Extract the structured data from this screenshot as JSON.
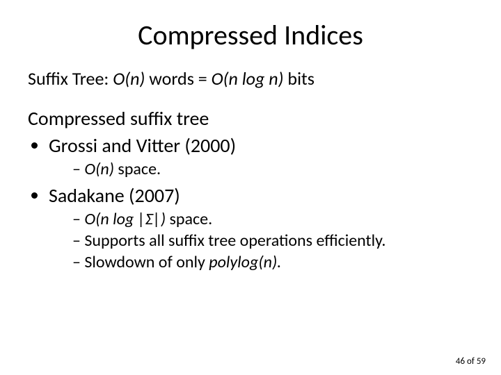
{
  "title": "Compressed Indices",
  "line1": {
    "prefix": "Suffix Tree: ",
    "o_n": "O(n)",
    "words_eq": " words = ",
    "o_nlogn": "O(n log n)",
    "bits": " bits"
  },
  "head2": "Compressed suffix tree",
  "bullet1": "Grossi and Vitter (2000)",
  "sub1": {
    "o_n": "O(n)",
    "space": " space."
  },
  "bullet2": "Sadakane (2007)",
  "sub2a": {
    "o": "O(n log |Σ|)",
    "space": " space."
  },
  "sub2b": "Supports all suffix tree operations efficiently.",
  "sub2c": {
    "prefix": "Slowdown of only ",
    "poly": "polylog(n).",
    "suffix": ""
  },
  "page": {
    "current": "46",
    "of": " of ",
    "total": "59"
  }
}
